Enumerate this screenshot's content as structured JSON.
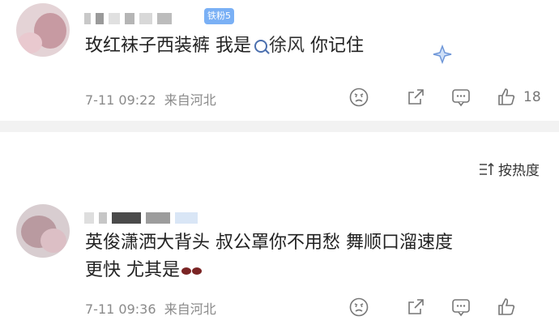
{
  "comments": [
    {
      "fan_badge": "铁粉5",
      "text_main": "玫红袜子西装裤 我是",
      "text_link": "徐风",
      "text_tail": " 你记住",
      "time": "7-11 09:22",
      "location": "来自河北",
      "like_count": "18"
    },
    {
      "line1": "英俊潇洒大背头 叔公罩你不用愁 舞顺口溜速度",
      "line2": "更快 尤其是",
      "time": "7-11 09:36",
      "location": "来自河北"
    }
  ],
  "sort_label": "按热度",
  "colors": {
    "badge": "#7ab0f5",
    "divider": "#f2f2f2",
    "meta": "#8a8a8a"
  },
  "icons": [
    "angry-face-icon",
    "share-icon",
    "comment-icon",
    "like-icon",
    "sort-icon",
    "search-icon"
  ]
}
